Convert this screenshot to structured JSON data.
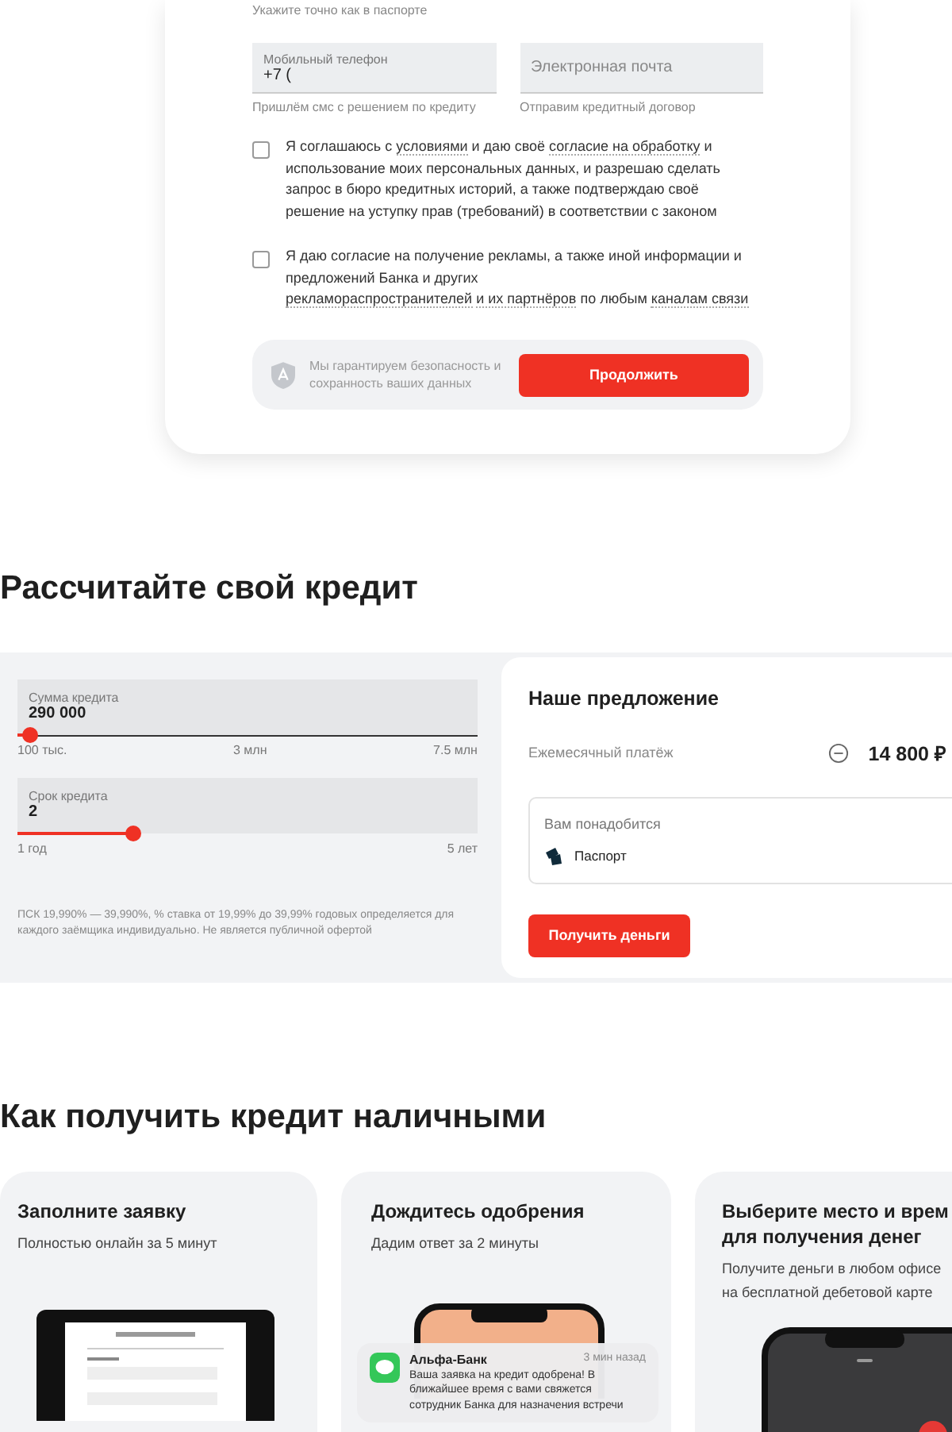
{
  "form": {
    "name_hint": "Укажите точно как в паспорте",
    "fields": [
      {
        "label": "Мобильный телефон",
        "value": "+7 (",
        "hint": "Пришлём смс с решением по кредиту"
      },
      {
        "placeholder": "Электронная почта",
        "hint": "Отправим кредитный договор"
      }
    ],
    "consents": [
      {
        "checked": false,
        "parts": [
          {
            "text": "Я соглашаюсь с "
          },
          {
            "text": "условиями",
            "link": true
          },
          {
            "text": " и даю своё "
          },
          {
            "text": "согласие на обработку",
            "link": true
          },
          {
            "text": " и использование моих персональных данных, и разрешаю сделать запрос в бюро кредитных историй, а также подтверждаю своё решение на уступку прав (требований) в соответствии с законом"
          }
        ]
      },
      {
        "checked": false,
        "parts": [
          {
            "text": "Я даю согласие на получение рекламы, а также иной информации и предложений Банка и других "
          },
          {
            "text": "рекламораспространителей",
            "link": true
          },
          {
            "text": "и их партнёров",
            "link": true
          },
          {
            "text": " по любым "
          },
          {
            "text": "каналам связи",
            "link": true
          }
        ]
      }
    ],
    "security_note": "Мы гарантируем безопасность и сохранность ваших данных",
    "submit": "Продолжить"
  },
  "calculator": {
    "title": "Рассчитайте свой кредит",
    "sliders": [
      {
        "label": "Сумма кредита",
        "value": "290 000",
        "level": 0.026,
        "ticks": [
          "100 тыс.",
          "3 млн",
          "7.5 млн"
        ]
      },
      {
        "label": "Срок кредита",
        "value": "2",
        "level": 0.25,
        "ticks": [
          "1 год",
          "5 лет"
        ]
      }
    ],
    "disclaimer": "ПСК 19,990% — 39,990%, % ставка от 19,99% до 39,99% годовых определяется для каждого заёмщика индивидуально. Не является публичной офертой",
    "offer": {
      "title": "Наше предложение",
      "payment_label": "Ежемесячный платёж",
      "payment": "14 800 ₽",
      "needs_title": "Вам понадобится",
      "needs": [
        "Паспорт"
      ],
      "button": "Получить деньги"
    }
  },
  "steps": {
    "title": "Как получить кредит наличными",
    "cards": [
      {
        "title": "Заполните заявку",
        "text": "Полностью онлайн за 5 минут",
        "kind": "laptop"
      },
      {
        "title": "Дождитесь одобрения",
        "text": "Дадим ответ за 2 минуты",
        "kind": "phone-notification",
        "notification": {
          "sender": "Альфа-Банк",
          "time": "3 мин назад",
          "message": "Ваша заявка на кредит одобрена! В ближайшее время с вами свяжется сотрудник Банка для назначения встречи"
        }
      },
      {
        "title": "Выберите место и врем",
        "title_2": "для получения денег",
        "text": "Получите деньги в любом офисе на бесплатной дебетовой карте",
        "kind": "phone-call"
      }
    ]
  }
}
